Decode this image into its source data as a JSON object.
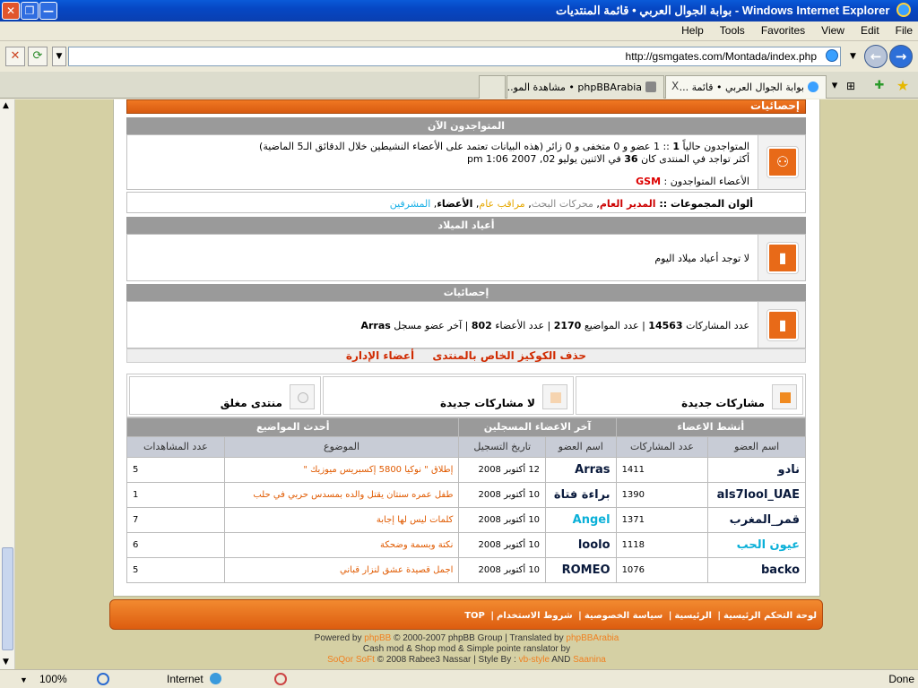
{
  "window": {
    "title": "بوابة الجوال العربي • قائمة المنتديات - Windows Internet Explorer",
    "close": "✕",
    "maximize": "❐",
    "minimize": "—"
  },
  "menu": [
    "File",
    "Edit",
    "View",
    "Favorites",
    "Tools",
    "Help"
  ],
  "address": {
    "url": "http://gsmgates.com/Montada/index.php"
  },
  "tabs": [
    {
      "label": "بوابة الجوال العربي • قائمة ...",
      "active": true,
      "close": "X"
    },
    {
      "label": "phpBBArabia • مشاهدة المو..."
    }
  ],
  "stats": {
    "header": "إحصائيات",
    "online_head": "المتواجدون الآن",
    "online_line1_pre": "المتواجدون حالياً ",
    "online_total": "1",
    "online_line1_post": " :: 1 عضو و 0 متخفى و 0 زائر (هذه البيانات تعتمد على الأعضاء النشيطين خلال الدقائق الـ5 الماضية)",
    "record_pre": "أكثر تواجد في المنتدى كان ",
    "record_num": "36",
    "record_post": " في الاثنين يوليو 02, 2007 1:06 pm",
    "members_online_label": "الأعضاء المتواجدون : ",
    "members_online_name": "GSM",
    "groups_label": "ألوان المجموعات :: ",
    "groups": [
      {
        "name": "المدير العام",
        "color": "#cc0000"
      },
      {
        "name": "محركات البحث",
        "color": "#888888"
      },
      {
        "name": "مراقب عام",
        "color": "#e6a800"
      },
      {
        "name": "الأعضاء",
        "color": "#000000"
      },
      {
        "name": "المشرفين",
        "color": "#1ab0e6"
      }
    ],
    "birthdays_head": "أعياد الميلاد",
    "birthdays_text": "لا توجد أعياد ميلاد اليوم",
    "stats_head": "إحصائيات",
    "posts_label": "عدد المشاركات ",
    "posts": "14563",
    "topics_label": " | عدد المواضيع ",
    "topics": "2170",
    "members_label": " | عدد الأعضاء ",
    "members": "802",
    "newest_label": " | آخر عضو مسجل ",
    "newest": "Arras"
  },
  "admin_links": [
    "حذف الكوكيز الخاص بالمنتدى",
    "أعضاء الإدارة"
  ],
  "legend": {
    "new_posts": "مشاركات جديدة",
    "no_new_posts": "لا مشاركات جديدة",
    "locked": "منتدى مغلق"
  },
  "top_table": {
    "groups": [
      "أنشط الاعضاء",
      "آخر الاعضاء المسجلين",
      "أحدث المواضيع"
    ],
    "cols": [
      "اسم العضو",
      "عدد المشاركات",
      "اسم العضو",
      "تاريخ التسجيل",
      "الموضوع",
      "عدد المشاهدات"
    ],
    "rows": [
      {
        "active_user": "نادو",
        "active_posts": "1411",
        "new_user": "Arras",
        "reg_date": "12 أكتوبر 2008",
        "topic": "إطلاق \" نوكيا 5800 إكسبريس ميوزيك \"",
        "views": "5"
      },
      {
        "active_user": "als7lool_UAE",
        "active_posts": "1390",
        "new_user": "براءة فتاة",
        "reg_date": "10 أكتوبر 2008",
        "topic": "طفل عمره سنتان يقتل والده بمسدس حربي في حلب",
        "views": "1"
      },
      {
        "active_user": "قمر_المغرب",
        "active_posts": "1371",
        "new_user": "Angel",
        "reg_date": "10 أكتوبر 2008",
        "topic": "كلمات ليس لها إجابة",
        "views": "7"
      },
      {
        "active_user": "عيون الحب",
        "active_posts": "1118",
        "new_user": "loolo",
        "reg_date": "10 أكتوبر 2008",
        "topic": "نكتة وبسمة وضحكة",
        "views": "6"
      },
      {
        "active_user": "backo",
        "active_posts": "1076",
        "new_user": "ROMEO",
        "reg_date": "10 أكتوبر 2008",
        "topic": "اجمل قصيدة عشق لنزار قباني",
        "views": "5"
      }
    ]
  },
  "footer_links": [
    "لوحة التحكم الرئيسية",
    "الرئيسية",
    "سياسة الخصوصية",
    "شروط الاستخدام",
    "TOP"
  ],
  "credits": {
    "l1_pre": "Powered by ",
    "phpbb": "phpBB",
    "l1_mid": " © 2000-2007 phpBB Group | Translated by ",
    "phpbbarabia": "phpBBArabia",
    "l2": "Cash mod & Shop mod & Simple pointe ranslator by",
    "soqor": "SoQor SoFt",
    "l3_mid": " © 2008 Rabee3 Nassar | Style By : ",
    "vbstyle": "vb-style",
    "and": " AND ",
    "saanina": "Saanina"
  },
  "status": {
    "done": "Done",
    "zone": "Internet",
    "zoom": "100%"
  },
  "colors": {
    "accent_orange": "#e86a18",
    "page_bg": "#d5d0a4",
    "header_gray": "#9a9a9a"
  }
}
